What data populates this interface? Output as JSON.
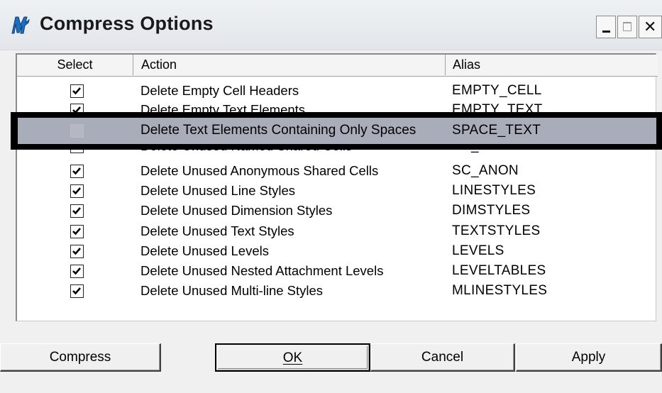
{
  "window": {
    "title": "Compress Options",
    "controls": {
      "minimize": "minimize",
      "maximize": "maximize",
      "close": "close"
    }
  },
  "table": {
    "columns": {
      "select": "Select",
      "action": "Action",
      "alias": "Alias"
    },
    "rows": [
      {
        "checked": true,
        "action": "Delete Empty Cell Headers",
        "alias": "EMPTY_CELL"
      },
      {
        "checked": true,
        "action": "Delete Empty Text Elements",
        "alias": "EMPTY_TEXT"
      },
      {
        "checked": false,
        "action": "Delete Text Elements Containing Only Spaces",
        "alias": "SPACE_TEXT",
        "highlighted": true
      },
      {
        "checked": true,
        "action": "Delete Unused Named Shared Cells",
        "alias": "SC_NAMED"
      },
      {
        "checked": true,
        "action": "Delete Unused Anonymous Shared Cells",
        "alias": "SC_ANON"
      },
      {
        "checked": true,
        "action": "Delete Unused Line Styles",
        "alias": "LINESTYLES"
      },
      {
        "checked": true,
        "action": "Delete Unused Dimension Styles",
        "alias": "DIMSTYLES"
      },
      {
        "checked": true,
        "action": "Delete Unused Text Styles",
        "alias": "TEXTSTYLES"
      },
      {
        "checked": true,
        "action": "Delete Unused Levels",
        "alias": "LEVELS"
      },
      {
        "checked": true,
        "action": "Delete Unused Nested Attachment Levels",
        "alias": "LEVELTABLES"
      },
      {
        "checked": true,
        "action": "Delete Unused Multi-line Styles",
        "alias": "MLINESTYLES"
      }
    ]
  },
  "buttons": {
    "compress": "Compress",
    "ok": "OK",
    "cancel": "Cancel",
    "apply": "Apply"
  },
  "colors": {
    "highlight_frame": "#000000",
    "highlight_row": "#a9adb9",
    "app_icon": "#1f6fc0"
  },
  "icons": {
    "app": "microstation-m-icon",
    "check": "checkmark-icon"
  }
}
